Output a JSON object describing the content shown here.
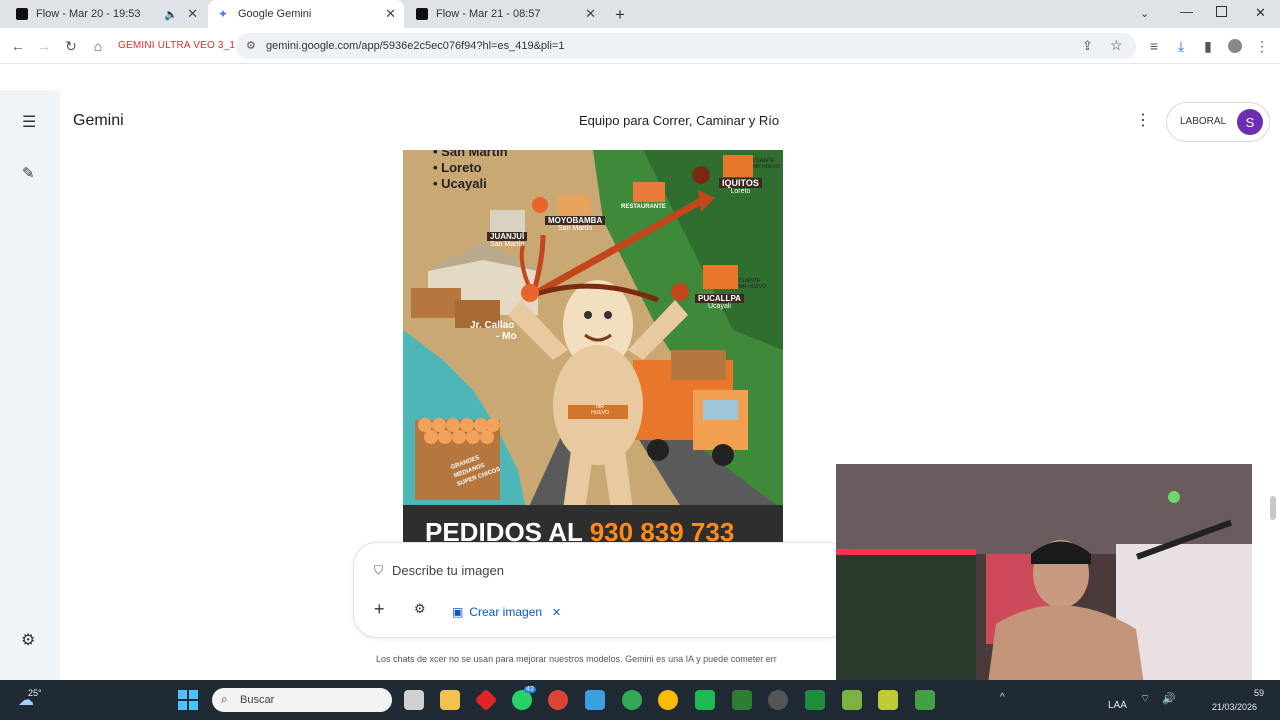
{
  "browser": {
    "tabs": [
      {
        "title": "Flow - Mar 20 - 19:53",
        "active": false
      },
      {
        "title": "Google Gemini",
        "active": true
      },
      {
        "title": "Flow - Mar 21 - 08:57",
        "active": false
      }
    ],
    "bookmark_label": "GEMINI ULTRA VEO 3_1",
    "url": "gemini.google.com/app/5936e2c5ec076f94?hl=es_419&pli=1"
  },
  "gemini": {
    "app_title": "Gemini",
    "conversation_title": "Equipo para Correr, Caminar y Río",
    "account_label": "LABORAL",
    "avatar_letter": "S",
    "prompt_placeholder": "Describe tu imagen",
    "tool_chip_label": "Crear imagen",
    "disclaimer": "Los chats de xcer no se usan para mejorar nuestros modelos. Gemini es una IA y puede cometer err"
  },
  "poster": {
    "regions": [
      "San Martín",
      "Loreto",
      "Ucayali"
    ],
    "cities": [
      {
        "name": "IQUITOS",
        "region": "Loreto"
      },
      {
        "name": "MOYOBAMBA",
        "region": "San Martín"
      },
      {
        "name": "JUANJUÍ",
        "region": "San Martín"
      },
      {
        "name": "PUCALLPA",
        "region": "Ucayali"
      }
    ],
    "restaurant_label": "RESTAURANTE",
    "client_label": "CLIENTE MR HUEVO",
    "origin_label": "Jr. Callao",
    "origin_suffix": "- Mo",
    "mascot_belt": "MR HUEVO",
    "crate_labels": "GRANDES MEDIANOS SUPER CHICOS",
    "footer_text": "PEDIDOS AL",
    "footer_phone": "930 839 733"
  },
  "taskbar": {
    "temperature": "25°",
    "search_placeholder": "Buscar",
    "language": "LAA",
    "time_fragment": "59",
    "date": "21/03/2026",
    "badge_count": "43"
  }
}
